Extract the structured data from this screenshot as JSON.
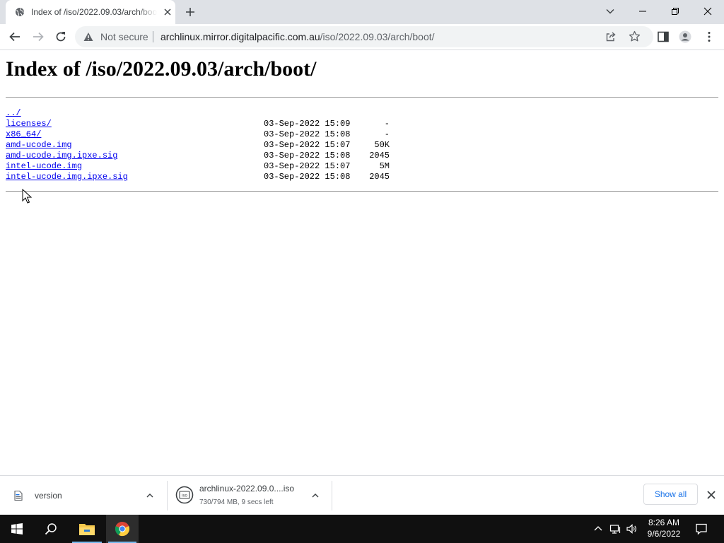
{
  "browser": {
    "tab": {
      "title": "Index of /iso/2022.09.03/arch/boot/"
    },
    "omnibox": {
      "security_label": "Not secure",
      "url_host": "archlinux.mirror.digitalpacific.com.au",
      "url_path": "/iso/2022.09.03/arch/boot/"
    }
  },
  "page": {
    "heading": "Index of /iso/2022.09.03/arch/boot/",
    "entries": [
      {
        "name": "../",
        "date": "",
        "size": ""
      },
      {
        "name": "licenses/",
        "date": "03-Sep-2022 15:09",
        "size": "-"
      },
      {
        "name": "x86_64/",
        "date": "03-Sep-2022 15:08",
        "size": "-"
      },
      {
        "name": "amd-ucode.img",
        "date": "03-Sep-2022 15:07",
        "size": "50K"
      },
      {
        "name": "amd-ucode.img.ipxe.sig",
        "date": "03-Sep-2022 15:08",
        "size": "2045"
      },
      {
        "name": "intel-ucode.img",
        "date": "03-Sep-2022 15:07",
        "size": "5M"
      },
      {
        "name": "intel-ucode.img.ipxe.sig",
        "date": "03-Sep-2022 15:08",
        "size": "2045"
      }
    ]
  },
  "downloads": {
    "items": [
      {
        "name": "version",
        "status": "",
        "icon": "file-icon"
      },
      {
        "name": "archlinux-2022.09.0....iso",
        "status": "730/794 MB, 9 secs left",
        "icon": "iso-disc-icon"
      }
    ],
    "show_all_label": "Show all"
  },
  "taskbar": {
    "time": "8:26 AM",
    "date": "9/6/2022"
  },
  "colors": {
    "link": "#0000ee",
    "tabstrip": "#dee1e6",
    "accent": "#1a73e8",
    "taskbar": "#101010"
  }
}
